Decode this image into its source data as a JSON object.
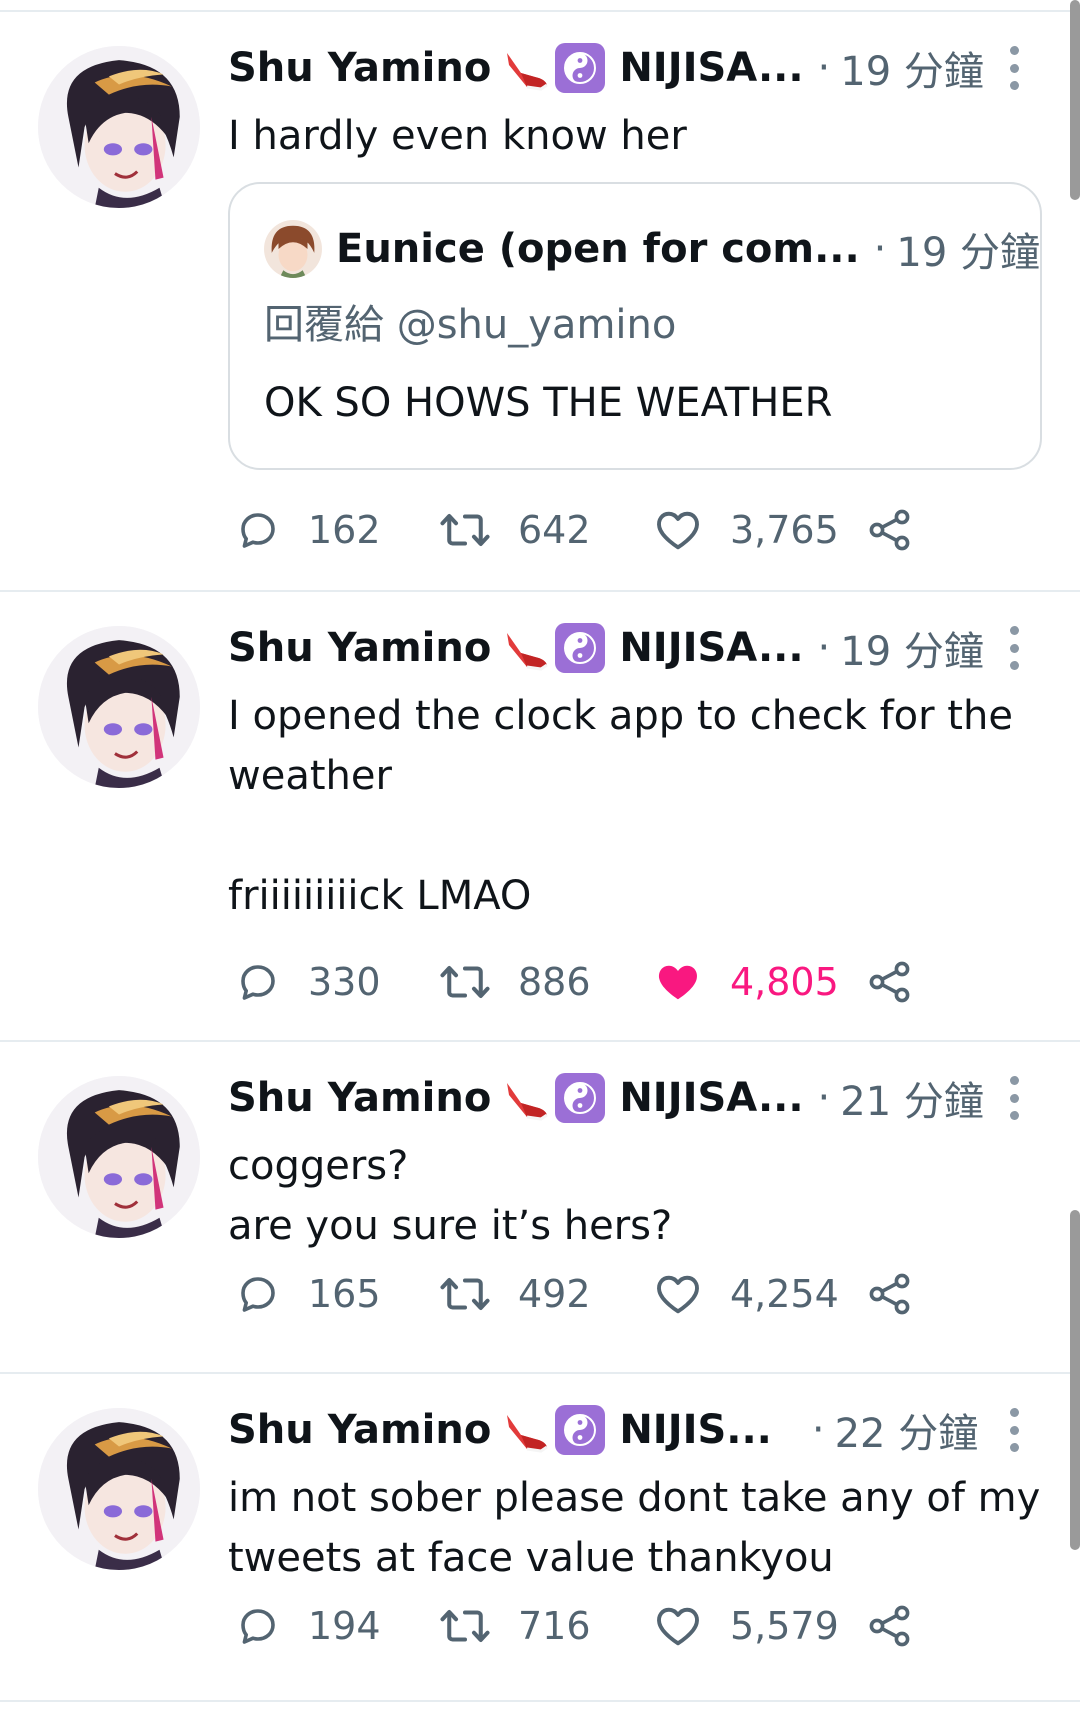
{
  "tweets": [
    {
      "name": "Shu Yamino",
      "handle": "NIJISA...",
      "time": "19 分鐘",
      "text": "I hardly even know her",
      "quote": {
        "name": "Eunice (open for com...",
        "time": "19 分鐘",
        "reply_prefix": "回覆給",
        "reply_to": "@shu_yamino",
        "text": "OK SO HOWS THE WEATHER"
      },
      "replies": "162",
      "retweets": "642",
      "likes": "3,765",
      "liked": false
    },
    {
      "name": "Shu Yamino",
      "handle": "NIJISA...",
      "time": "19 分鐘",
      "text": "I opened the clock app to check for the weather\n\nfriiiiiiiiick LMAO",
      "replies": "330",
      "retweets": "886",
      "likes": "4,805",
      "liked": true
    },
    {
      "name": "Shu Yamino",
      "handle": "NIJISA...",
      "time": "21 分鐘",
      "text": "coggers?\nare you sure it’s hers?",
      "replies": "165",
      "retweets": "492",
      "likes": "4,254",
      "liked": false
    },
    {
      "name": "Shu Yamino",
      "handle": "NIJIS...",
      "time": "22 分鐘",
      "text": "im not sober please dont take any of my tweets at face value thankyou",
      "replies": "194",
      "retweets": "716",
      "likes": "5,579",
      "liked": false
    }
  ],
  "separator": "·",
  "icons": {
    "reply": "reply-icon",
    "retweet": "retweet-icon",
    "like": "heart-icon",
    "share": "share-icon",
    "sneaker": "sneaker-emoji-icon",
    "yin_yang": "yin-yang-emoji-icon",
    "more": "more-dots-icon"
  },
  "colors": {
    "text": "#0f1419",
    "secondary": "#536471",
    "like_active": "#f91880",
    "divider": "#e6ecf0"
  }
}
